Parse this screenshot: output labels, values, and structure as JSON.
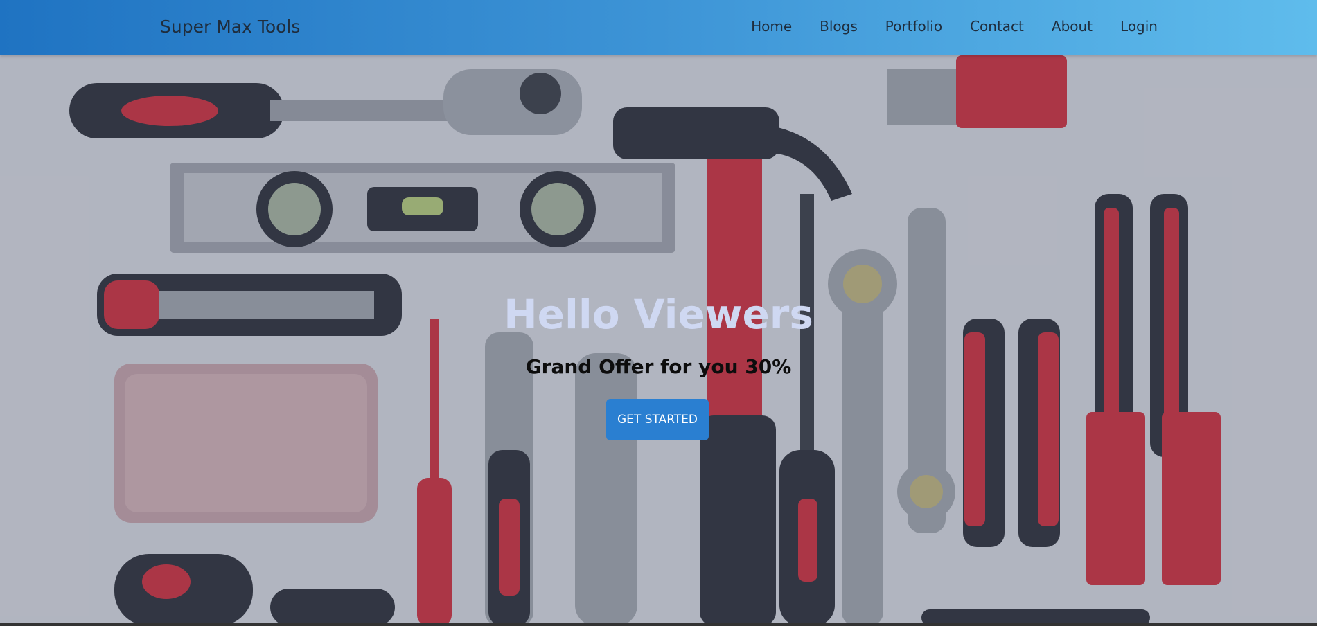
{
  "header": {
    "brand": "Super Max Tools",
    "nav": [
      "Home",
      "Blogs",
      "Portfolio",
      "Contact",
      "About",
      "Login"
    ]
  },
  "hero": {
    "title": "Hello Viewers",
    "subtitle": "Grand Offer for you 30%",
    "button_label": "GET STARTED"
  },
  "colors": {
    "header_start": "#1f73c2",
    "header_end": "#5fbcec",
    "button": "#2a7fd1",
    "tool_red": "#d32f3b",
    "tool_dark": "#2b2f36"
  }
}
